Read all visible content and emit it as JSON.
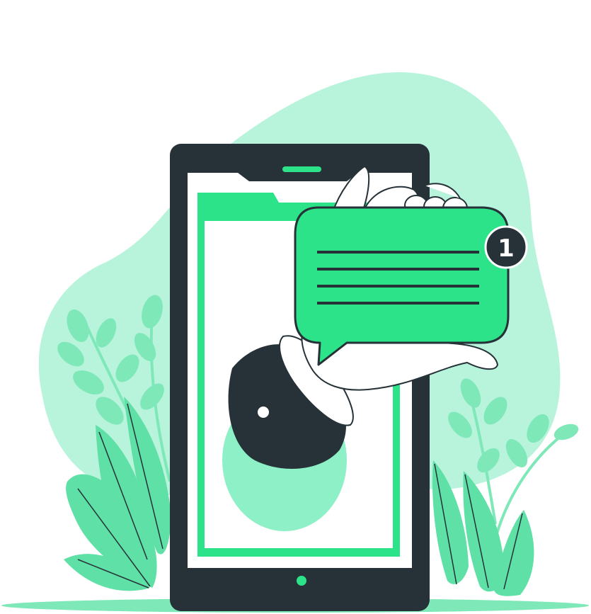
{
  "notification": {
    "badge_count": "1"
  },
  "colors": {
    "blob": "#b8f3dc",
    "leaf_light": "#7ee8b8",
    "leaf_mid": "#5ee0a6",
    "accent_green": "#2ce38a",
    "inner_green": "#8ef0c6",
    "outline_dark": "#263238",
    "white": "#ffffff"
  },
  "icons": {
    "message": "chat-bubble-icon",
    "badge": "notification-badge-icon"
  }
}
